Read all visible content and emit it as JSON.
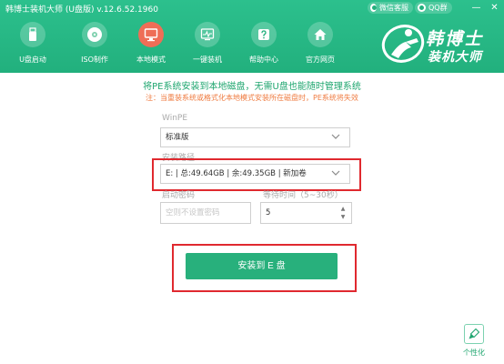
{
  "app": {
    "title": "韩博士装机大师 (U盘版) v.12.6.52.1960",
    "wechat_label": "微信客服",
    "qq_label": "QQ群",
    "minimize_glyph": "—",
    "close_glyph": "✕"
  },
  "nav": {
    "items": [
      {
        "label": "U盘启动",
        "icon": "usb-drive-icon"
      },
      {
        "label": "ISO制作",
        "icon": "disc-icon"
      },
      {
        "label": "本地模式",
        "icon": "monitor-icon",
        "active": true
      },
      {
        "label": "一键装机",
        "icon": "install-screen-icon"
      },
      {
        "label": "帮助中心",
        "icon": "help-icon"
      },
      {
        "label": "官方网页",
        "icon": "home-icon"
      }
    ]
  },
  "logo": {
    "name": "韩博士",
    "subtitle": "装机大师"
  },
  "main": {
    "title": "将PE系统安装到本地磁盘，无需U盘也能随时管理系统",
    "note": "注：当重装系统或格式化本地模式安装所在磁盘时，PE系统将失效",
    "winpe_label": "WinPE",
    "winpe_value": "标准版",
    "install_path_label": "安装路径",
    "install_path_value": "E: | 总:49.64GB | 余:49.35GB | 新加卷",
    "password_label": "启动密码",
    "password_placeholder": "空则不设置密码",
    "wait_label": "等待时间（5~30秒）",
    "wait_value": "5",
    "install_button": "安装到 E 盘"
  },
  "footer": {
    "personalize_label": "个性化"
  },
  "colors": {
    "header_green": "#22b07d",
    "active_tab": "#ee6e57",
    "title_green": "#1fa66f",
    "note_orange": "#ef7b40",
    "highlight_red": "#e0292f",
    "button_green": "#28b07c"
  }
}
